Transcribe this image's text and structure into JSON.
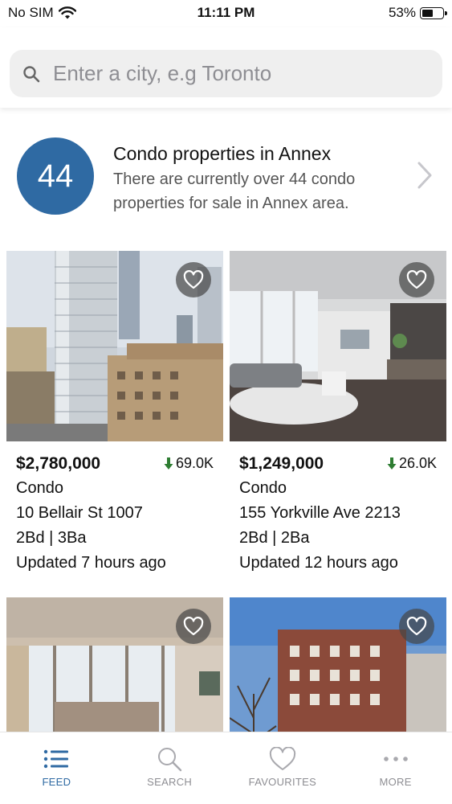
{
  "status_bar": {
    "carrier": "No SIM",
    "time": "11:11 PM",
    "battery": "53%",
    "battery_level": 0.53
  },
  "search": {
    "placeholder": "Enter a city, e.g Toronto"
  },
  "summary": {
    "count": "44",
    "title": "Condo properties in Annex",
    "description": "There are currently over 44 condo properties for sale in Annex area.",
    "accent_color": "#2f6aa3"
  },
  "listings": [
    {
      "price": "$2,780,000",
      "change": "69.0K",
      "change_direction": "down",
      "type": "Condo",
      "address": "10 Bellair St 1007",
      "rooms": "2Bd | 3Ba",
      "updated": "Updated 7 hours ago"
    },
    {
      "price": "$1,249,000",
      "change": "26.0K",
      "change_direction": "down",
      "type": "Condo",
      "address": "155 Yorkville Ave 2213",
      "rooms": "2Bd | 2Ba",
      "updated": "Updated 12 hours ago"
    },
    {},
    {}
  ],
  "tabs": [
    {
      "label": "FEED",
      "icon": "list-icon",
      "active": true
    },
    {
      "label": "SEARCH",
      "icon": "search-icon",
      "active": false
    },
    {
      "label": "FAVOURITES",
      "icon": "heart-icon",
      "active": false
    },
    {
      "label": "MORE",
      "icon": "more-dots-icon",
      "active": false
    }
  ],
  "colors": {
    "accent": "#2f6aa3",
    "price_drop": "#2e7d32"
  }
}
